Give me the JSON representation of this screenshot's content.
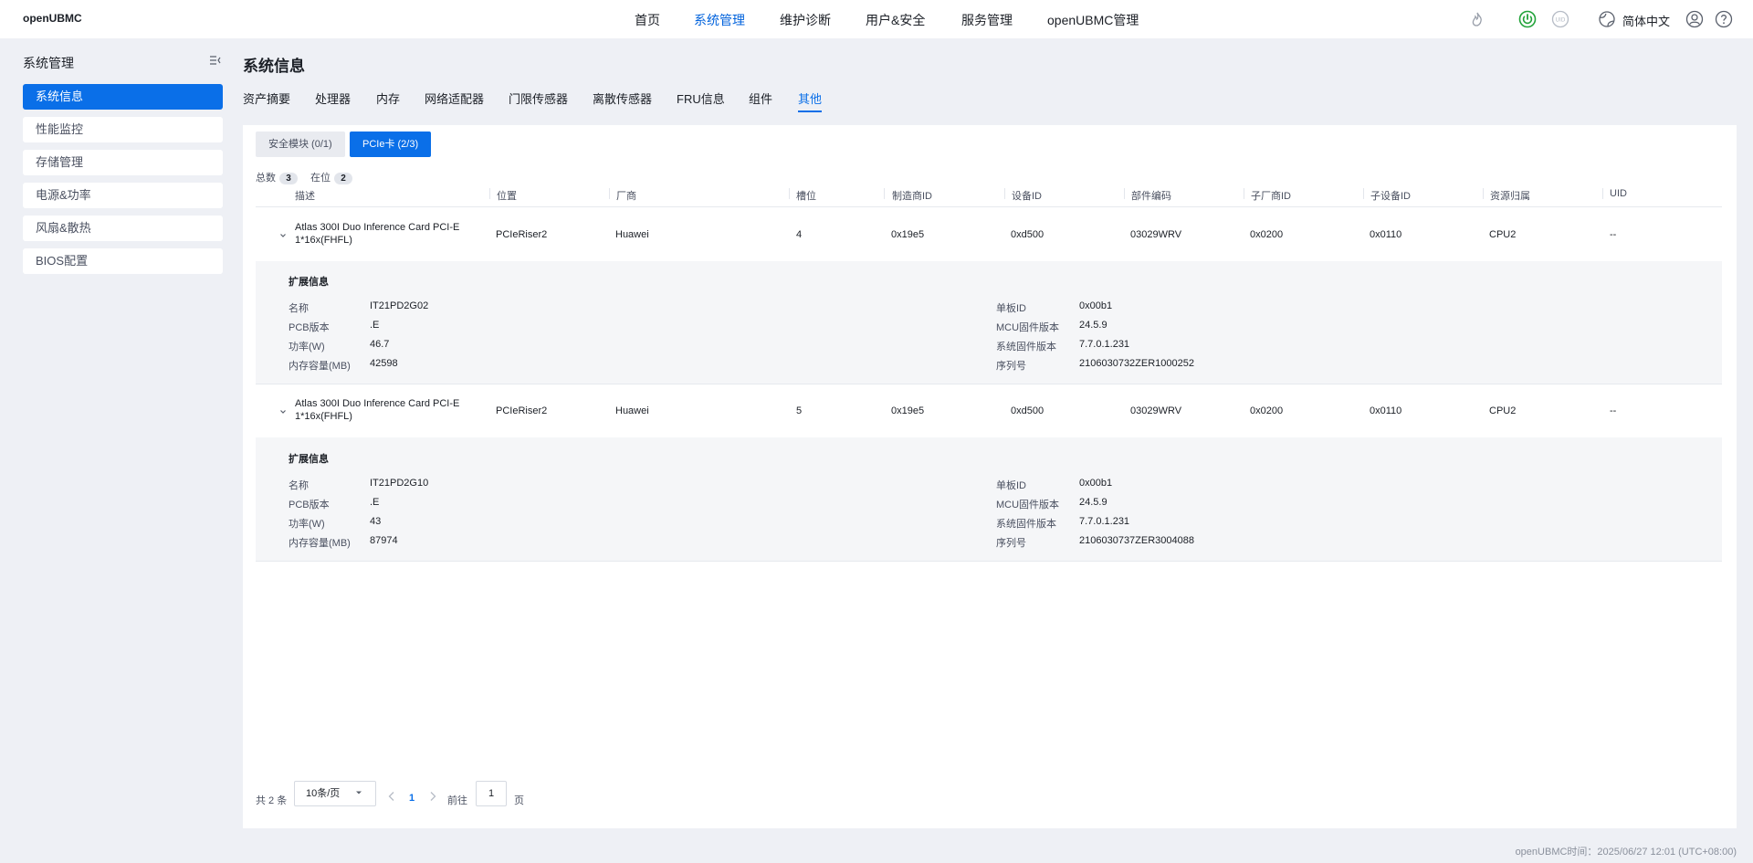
{
  "header": {
    "logo": "openUBMC",
    "nav": [
      "首页",
      "系统管理",
      "维护诊断",
      "用户&安全",
      "服务管理",
      "openUBMC管理"
    ],
    "language": "简体中文",
    "uid_label": "UID"
  },
  "sidebar": {
    "title": "系统管理",
    "items": [
      "系统信息",
      "性能监控",
      "存储管理",
      "电源&功率",
      "风扇&散热",
      "BIOS配置"
    ]
  },
  "page": {
    "title": "系统信息",
    "tabs": [
      "资产摘要",
      "处理器",
      "内存",
      "网络适配器",
      "门限传感器",
      "离散传感器",
      "FRU信息",
      "组件",
      "其他"
    ]
  },
  "subtabs": [
    "安全模块 (0/1)",
    "PCIe卡 (2/3)"
  ],
  "counts": {
    "total_label": "总数",
    "total": "3",
    "present_label": "在位",
    "present": "2"
  },
  "table": {
    "columns": [
      "描述",
      "位置",
      "厂商",
      "槽位",
      "制造商ID",
      "设备ID",
      "部件编码",
      "子厂商ID",
      "子设备ID",
      "资源归属",
      "UID"
    ],
    "rows": [
      {
        "desc": "Atlas 300I Duo Inference Card PCI-E 1*16x(FHFL)",
        "location": "PCIeRiser2",
        "vendor": "Huawei",
        "slot": "4",
        "vendor_id": "0x19e5",
        "device_id": "0xd500",
        "part_no": "03029WRV",
        "sub_vendor_id": "0x0200",
        "sub_device_id": "0x0110",
        "resource": "CPU2",
        "uid": "--",
        "ext": {
          "title": "扩展信息",
          "left": [
            {
              "k": "名称",
              "v": "IT21PD2G02"
            },
            {
              "k": "PCB版本",
              "v": ".E"
            },
            {
              "k": "功率(W)",
              "v": "46.7"
            },
            {
              "k": "内存容量(MB)",
              "v": "42598"
            }
          ],
          "right": [
            {
              "k": "单板ID",
              "v": "0x00b1"
            },
            {
              "k": "MCU固件版本",
              "v": "24.5.9"
            },
            {
              "k": "系统固件版本",
              "v": "7.7.0.1.231"
            },
            {
              "k": "序列号",
              "v": "2106030732ZER1000252"
            }
          ]
        }
      },
      {
        "desc": "Atlas 300I Duo Inference Card PCI-E 1*16x(FHFL)",
        "location": "PCIeRiser2",
        "vendor": "Huawei",
        "slot": "5",
        "vendor_id": "0x19e5",
        "device_id": "0xd500",
        "part_no": "03029WRV",
        "sub_vendor_id": "0x0200",
        "sub_device_id": "0x0110",
        "resource": "CPU2",
        "uid": "--",
        "ext": {
          "title": "扩展信息",
          "left": [
            {
              "k": "名称",
              "v": "IT21PD2G10"
            },
            {
              "k": "PCB版本",
              "v": ".E"
            },
            {
              "k": "功率(W)",
              "v": "43"
            },
            {
              "k": "内存容量(MB)",
              "v": "87974"
            }
          ],
          "right": [
            {
              "k": "单板ID",
              "v": "0x00b1"
            },
            {
              "k": "MCU固件版本",
              "v": "24.5.9"
            },
            {
              "k": "系统固件版本",
              "v": "7.7.0.1.231"
            },
            {
              "k": "序列号",
              "v": "2106030737ZER3004088"
            }
          ]
        }
      }
    ]
  },
  "pagination": {
    "total_text": "共 2 条",
    "page_size": "10条/页",
    "current": "1",
    "goto_label": "前往",
    "goto_value": "1",
    "page_suffix": "页"
  },
  "footer": "openUBMC时间：2025/06/27 12:01 (UTC+08:00)",
  "colors": {
    "accent": "#0a6fe8",
    "power_green": "#22a33a"
  }
}
